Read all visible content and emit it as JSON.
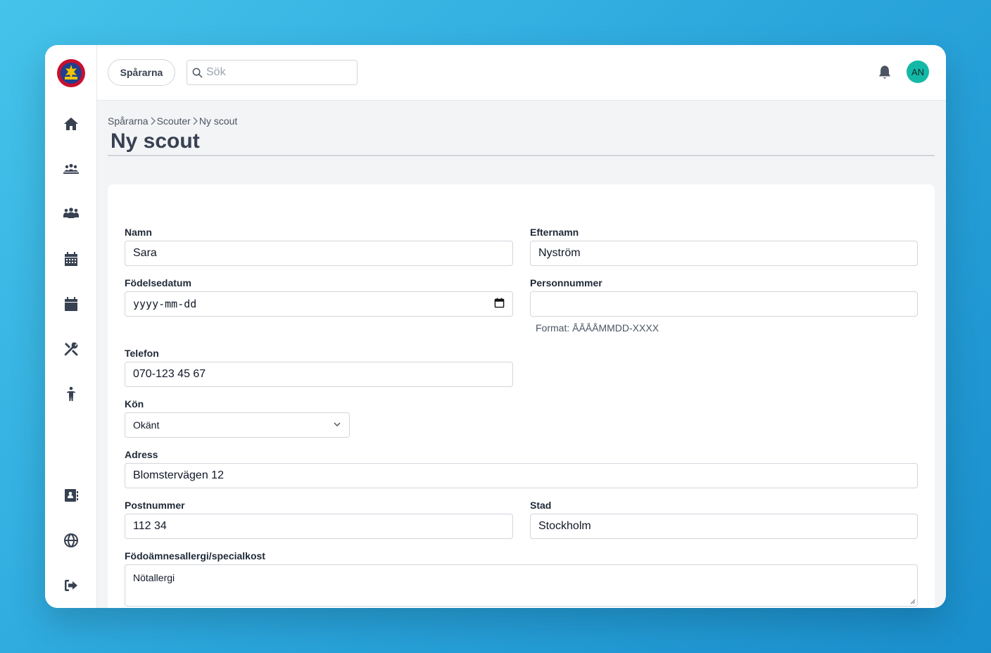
{
  "topbar": {
    "org_button": "Spårarna",
    "search_placeholder": "Sök",
    "avatar_initials": "AN"
  },
  "sidebar": {
    "items": [
      {
        "name": "home",
        "icon": "home-icon"
      },
      {
        "name": "groups",
        "icon": "groups-icon"
      },
      {
        "name": "people",
        "icon": "people-icon"
      },
      {
        "name": "calendar",
        "icon": "calendar-icon"
      },
      {
        "name": "events",
        "icon": "calendar-solid-icon"
      },
      {
        "name": "tools",
        "icon": "tools-icon"
      },
      {
        "name": "scout",
        "icon": "child-icon"
      },
      {
        "name": "contacts",
        "icon": "address-book-icon"
      },
      {
        "name": "web",
        "icon": "globe-icon"
      },
      {
        "name": "logout",
        "icon": "sign-out-icon"
      }
    ]
  },
  "breadcrumb": {
    "items": [
      "Spårarna",
      "Scouter",
      "Ny scout"
    ]
  },
  "page": {
    "title": "Ny scout"
  },
  "form": {
    "first_name": {
      "label": "Namn",
      "value": "Sara"
    },
    "last_name": {
      "label": "Efternamn",
      "value": "Nyström"
    },
    "birth_date": {
      "label": "Födelsedatum",
      "value": "yyyy-mm-dd"
    },
    "personal_number": {
      "label": "Personnummer",
      "value": "",
      "help": "Format: ÅÅÅÅMMDD-XXXX"
    },
    "phone": {
      "label": "Telefon",
      "value": "070-123 45 67"
    },
    "gender": {
      "label": "Kön",
      "value": "Okänt"
    },
    "address": {
      "label": "Adress",
      "value": "Blomstervägen 12"
    },
    "postal_code": {
      "label": "Postnummer",
      "value": "112 34"
    },
    "city": {
      "label": "Stad",
      "value": "Stockholm"
    },
    "allergies": {
      "label": "Födoämnesallergi/specialkost",
      "value": "Nötallergi"
    }
  },
  "colors": {
    "avatar": "#14b8a6",
    "background_gradient_start": "#45c3ea",
    "background_gradient_end": "#1a8fcd"
  }
}
